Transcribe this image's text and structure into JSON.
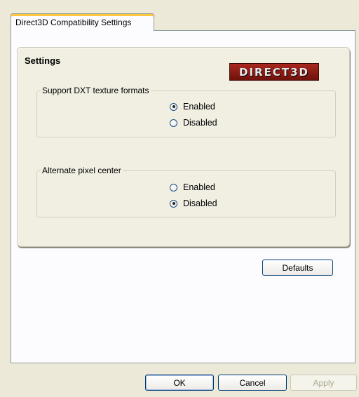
{
  "tabs": [
    {
      "label": "Direct3D Compatibility Settings",
      "active": true
    }
  ],
  "settings": {
    "title": "Settings",
    "logo_text": "DIRECT3D",
    "groups": [
      {
        "label": "Support DXT texture formats",
        "options": [
          {
            "label": "Enabled",
            "checked": true
          },
          {
            "label": "Disabled",
            "checked": false
          }
        ]
      },
      {
        "label": "Alternate pixel center",
        "options": [
          {
            "label": "Enabled",
            "checked": false
          },
          {
            "label": "Disabled",
            "checked": true
          }
        ]
      }
    ]
  },
  "buttons": {
    "defaults": "Defaults",
    "ok": "OK",
    "cancel": "Cancel",
    "apply": "Apply"
  }
}
